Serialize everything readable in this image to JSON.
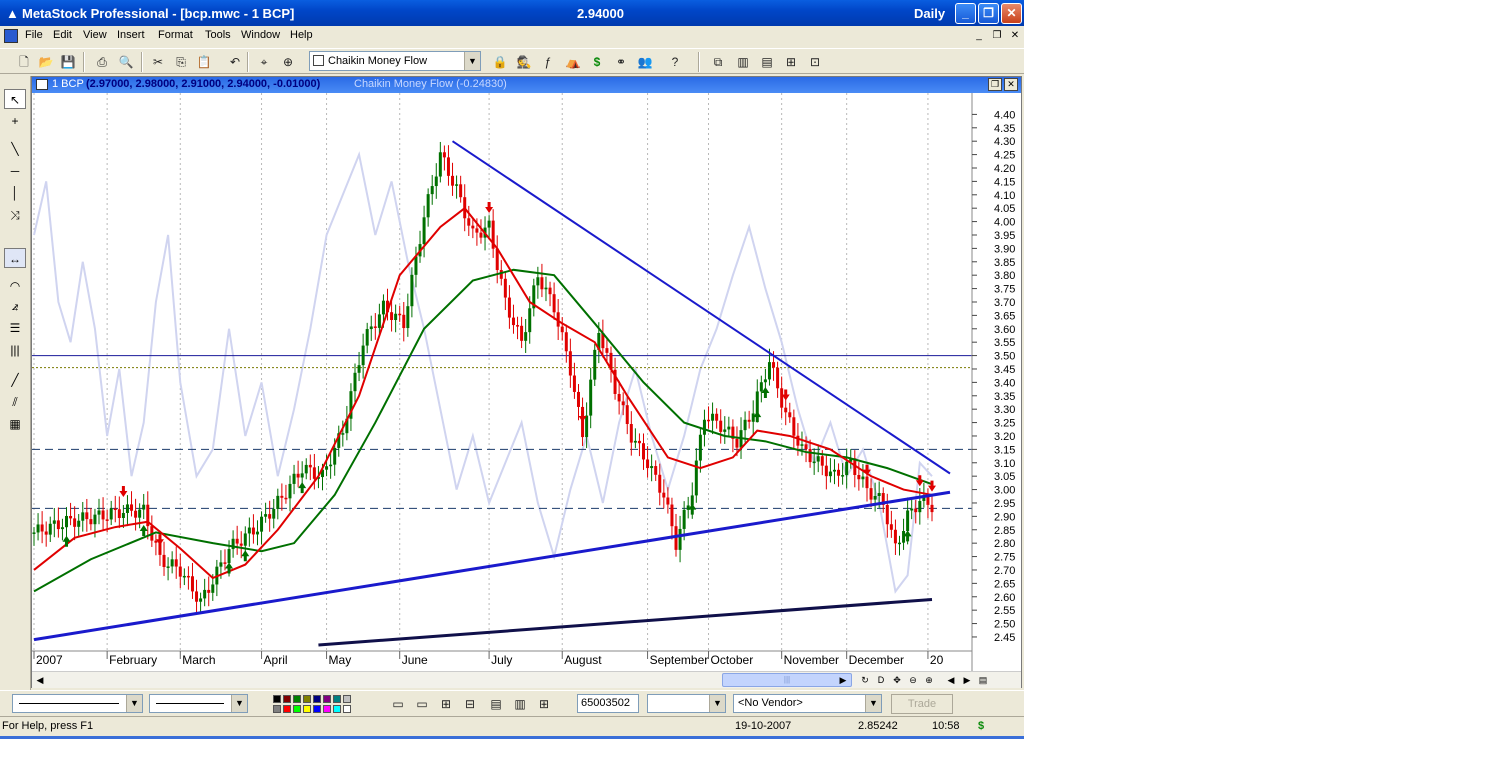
{
  "titlebar": {
    "title": "MetaStock Professional - [bcp.mwc - 1 BCP]",
    "last_price": "2.94000",
    "periodicity": "Daily",
    "min_glyph": "_",
    "max_glyph": "❐",
    "close_glyph": "✕"
  },
  "menu": {
    "items": [
      "File",
      "Edit",
      "View",
      "Insert",
      "Format",
      "Tools",
      "Window",
      "Help"
    ],
    "mdi_min": "_",
    "mdi_restore": "❐",
    "mdi_close": "✕"
  },
  "toolbar": {
    "indicator_select": "Chaikin Money Flow",
    "dropdown_glyph": "▼"
  },
  "chart": {
    "header_security": "1 BCP",
    "header_ohlc": "(2.97000, 2.98000, 2.91000, 2.94000, -0.01000)",
    "header_indicator": "Chaikin Money Flow (-0.24830)",
    "restore_glyph": "❐",
    "close_glyph": "✕"
  },
  "chart_data": {
    "type": "candlestick",
    "security": "BCP",
    "periodicity": "Daily",
    "x_labels": [
      "2007",
      "February",
      "March",
      "April",
      "May",
      "June",
      "July",
      "August",
      "September",
      "October",
      "November",
      "December",
      "20"
    ],
    "y_ticks": [
      "4.40",
      "4.35",
      "4.30",
      "4.25",
      "4.20",
      "4.15",
      "4.10",
      "4.05",
      "4.00",
      "3.95",
      "3.90",
      "3.85",
      "3.80",
      "3.75",
      "3.70",
      "3.65",
      "3.60",
      "3.55",
      "3.50",
      "3.45",
      "3.40",
      "3.35",
      "3.30",
      "3.25",
      "3.20",
      "3.15",
      "3.10",
      "3.05",
      "3.00",
      "2.95",
      "2.90",
      "2.85",
      "2.80",
      "2.75",
      "2.70",
      "2.65",
      "2.60",
      "2.55",
      "2.50",
      "2.45"
    ],
    "ylim": [
      2.42,
      4.45
    ],
    "price_series": [
      {
        "day": 0,
        "close": 2.84
      },
      {
        "day": 8,
        "close": 2.88
      },
      {
        "day": 16,
        "close": 2.9
      },
      {
        "day": 22,
        "close": 2.92
      },
      {
        "day": 27,
        "close": 2.92
      },
      {
        "day": 31,
        "close": 2.74
      },
      {
        "day": 36,
        "close": 2.7
      },
      {
        "day": 41,
        "close": 2.58
      },
      {
        "day": 44,
        "close": 2.66
      },
      {
        "day": 48,
        "close": 2.78
      },
      {
        "day": 55,
        "close": 2.86
      },
      {
        "day": 61,
        "close": 2.97
      },
      {
        "day": 66,
        "close": 3.08
      },
      {
        "day": 71,
        "close": 3.05
      },
      {
        "day": 76,
        "close": 3.22
      },
      {
        "day": 81,
        "close": 3.55
      },
      {
        "day": 86,
        "close": 3.68
      },
      {
        "day": 91,
        "close": 3.62
      },
      {
        "day": 96,
        "close": 4.02
      },
      {
        "day": 100,
        "close": 4.25
      },
      {
        "day": 104,
        "close": 4.12
      },
      {
        "day": 108,
        "close": 3.95
      },
      {
        "day": 112,
        "close": 3.98
      },
      {
        "day": 116,
        "close": 3.7
      },
      {
        "day": 120,
        "close": 3.55
      },
      {
        "day": 124,
        "close": 3.8
      },
      {
        "day": 128,
        "close": 3.68
      },
      {
        "day": 132,
        "close": 3.45
      },
      {
        "day": 135,
        "close": 3.2
      },
      {
        "day": 139,
        "close": 3.6
      },
      {
        "day": 143,
        "close": 3.38
      },
      {
        "day": 147,
        "close": 3.2
      },
      {
        "day": 151,
        "close": 3.1
      },
      {
        "day": 155,
        "close": 2.98
      },
      {
        "day": 158,
        "close": 2.8
      },
      {
        "day": 162,
        "close": 3.0
      },
      {
        "day": 165,
        "close": 3.28
      },
      {
        "day": 169,
        "close": 3.24
      },
      {
        "day": 173,
        "close": 3.18
      },
      {
        "day": 177,
        "close": 3.3
      },
      {
        "day": 181,
        "close": 3.48
      },
      {
        "day": 185,
        "close": 3.28
      },
      {
        "day": 189,
        "close": 3.15
      },
      {
        "day": 193,
        "close": 3.1
      },
      {
        "day": 197,
        "close": 3.05
      },
      {
        "day": 201,
        "close": 3.1
      },
      {
        "day": 205,
        "close": 3.0
      },
      {
        "day": 209,
        "close": 2.95
      },
      {
        "day": 212,
        "close": 2.78
      },
      {
        "day": 215,
        "close": 2.9
      },
      {
        "day": 218,
        "close": 2.96
      },
      {
        "day": 221,
        "close": 2.94
      }
    ],
    "series": [
      {
        "name": "",
        "color": "#e00000",
        "values_by_day": [
          [
            0,
            2.7
          ],
          [
            10,
            2.82
          ],
          [
            20,
            2.86
          ],
          [
            28,
            2.88
          ],
          [
            36,
            2.78
          ],
          [
            44,
            2.67
          ],
          [
            52,
            2.72
          ],
          [
            60,
            2.85
          ],
          [
            70,
            3.05
          ],
          [
            80,
            3.35
          ],
          [
            90,
            3.8
          ],
          [
            100,
            3.98
          ],
          [
            106,
            4.05
          ],
          [
            114,
            3.9
          ],
          [
            122,
            3.7
          ],
          [
            130,
            3.62
          ],
          [
            138,
            3.55
          ],
          [
            146,
            3.35
          ],
          [
            156,
            3.12
          ],
          [
            164,
            3.08
          ],
          [
            172,
            3.12
          ],
          [
            178,
            3.22
          ],
          [
            186,
            3.2
          ],
          [
            196,
            3.15
          ],
          [
            206,
            3.05
          ],
          [
            214,
            3.0
          ],
          [
            221,
            2.98
          ]
        ]
      },
      {
        "name": "",
        "color": "#007000",
        "values_by_day": [
          [
            0,
            2.62
          ],
          [
            14,
            2.74
          ],
          [
            30,
            2.84
          ],
          [
            44,
            2.8
          ],
          [
            56,
            2.77
          ],
          [
            64,
            2.8
          ],
          [
            74,
            2.98
          ],
          [
            84,
            3.25
          ],
          [
            96,
            3.6
          ],
          [
            108,
            3.78
          ],
          [
            118,
            3.82
          ],
          [
            128,
            3.8
          ],
          [
            138,
            3.62
          ],
          [
            150,
            3.4
          ],
          [
            160,
            3.25
          ],
          [
            170,
            3.2
          ],
          [
            180,
            3.18
          ],
          [
            190,
            3.14
          ],
          [
            200,
            3.12
          ],
          [
            210,
            3.08
          ],
          [
            221,
            3.02
          ]
        ]
      },
      {
        "name": "",
        "color": "#d0d4f0",
        "values_by_day": [
          [
            0,
            3.95
          ],
          [
            3,
            4.15
          ],
          [
            6,
            3.7
          ],
          [
            9,
            3.55
          ],
          [
            12,
            3.85
          ],
          [
            15,
            3.6
          ],
          [
            18,
            3.2
          ],
          [
            21,
            3.45
          ],
          [
            24,
            3.05
          ],
          [
            27,
            3.25
          ],
          [
            30,
            3.7
          ],
          [
            33,
            3.95
          ],
          [
            36,
            3.4
          ],
          [
            40,
            3.05
          ],
          [
            44,
            3.15
          ],
          [
            48,
            3.6
          ],
          [
            52,
            3.2
          ],
          [
            56,
            3.4
          ],
          [
            60,
            3.05
          ],
          [
            64,
            3.3
          ],
          [
            68,
            3.6
          ],
          [
            72,
            3.95
          ],
          [
            76,
            4.1
          ],
          [
            80,
            4.25
          ],
          [
            84,
            3.95
          ],
          [
            88,
            4.15
          ],
          [
            92,
            3.85
          ],
          [
            96,
            3.6
          ],
          [
            100,
            3.3
          ],
          [
            104,
            3.0
          ],
          [
            108,
            3.2
          ],
          [
            112,
            2.95
          ],
          [
            116,
            3.1
          ],
          [
            120,
            3.25
          ],
          [
            124,
            2.95
          ],
          [
            128,
            2.75
          ],
          [
            132,
            3.0
          ],
          [
            136,
            3.2
          ],
          [
            140,
            2.95
          ],
          [
            144,
            3.25
          ],
          [
            148,
            3.45
          ],
          [
            152,
            3.2
          ],
          [
            156,
            3.0
          ],
          [
            160,
            3.2
          ],
          [
            164,
            3.45
          ],
          [
            168,
            3.6
          ],
          [
            172,
            3.8
          ],
          [
            176,
            3.98
          ],
          [
            180,
            3.75
          ],
          [
            184,
            3.55
          ],
          [
            188,
            3.3
          ],
          [
            192,
            3.1
          ],
          [
            196,
            3.25
          ],
          [
            200,
            3.05
          ],
          [
            204,
            3.15
          ],
          [
            208,
            2.95
          ],
          [
            212,
            2.62
          ],
          [
            215,
            2.68
          ],
          [
            218,
            3.1
          ],
          [
            221,
            3.05
          ]
        ]
      }
    ],
    "annotations": {
      "horizontal_lines": [
        3.5,
        3.455,
        3.15,
        2.93
      ],
      "resistance_trendline": [
        [
          103,
          4.3
        ],
        [
          221,
          3.06
        ]
      ],
      "support_trendline": [
        [
          0,
          2.44
        ],
        [
          221,
          2.99
        ]
      ],
      "lower_channel_line": [
        [
          70,
          2.42
        ],
        [
          221,
          2.59
        ]
      ]
    }
  },
  "bottom_toolbar": {
    "line_style_value": "",
    "line_weight_value": "",
    "volume_field": "65003502",
    "empty_combo": "",
    "vendor_select": "<No Vendor>",
    "trade_label": "Trade",
    "dropdown_glyph": "▼"
  },
  "status": {
    "help_text": "For Help, press F1",
    "date": "19-10-2007",
    "value": "2.85242",
    "time": "10:58",
    "dollar_glyph": "$"
  }
}
